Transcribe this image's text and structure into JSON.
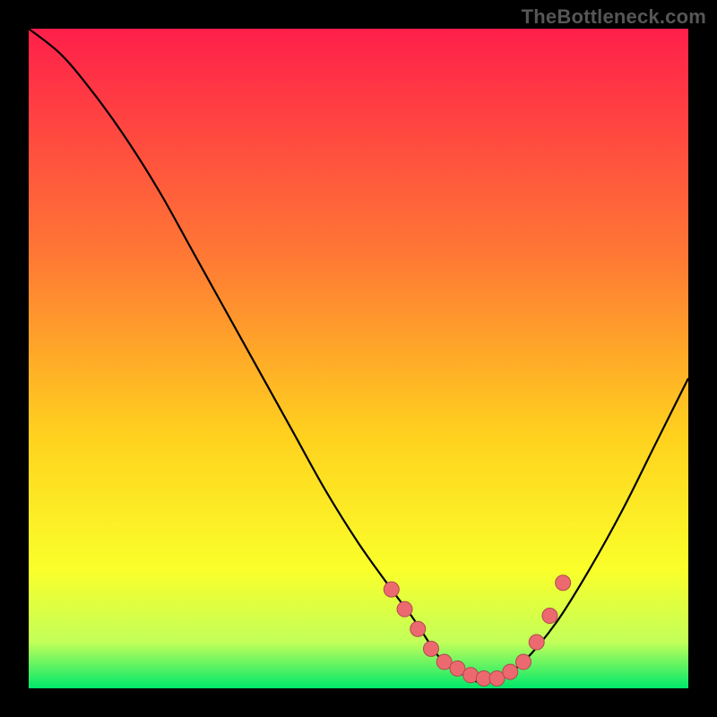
{
  "watermark": "TheBottleneck.com",
  "colors": {
    "top": "#ff1f4a",
    "mid1": "#ff7a34",
    "mid2": "#ffd21e",
    "mid3": "#faff2a",
    "mid4": "#c2ff59",
    "bottom": "#00e86b",
    "curve": "#000000",
    "marker_fill": "#ec6a6f",
    "marker_stroke": "#b04a4f"
  },
  "chart_data": {
    "type": "line",
    "title": "",
    "xlabel": "",
    "ylabel": "",
    "xlim": [
      0,
      100
    ],
    "ylim": [
      0,
      100
    ],
    "x": [
      0,
      5,
      10,
      15,
      20,
      25,
      30,
      35,
      40,
      45,
      50,
      55,
      58,
      60,
      62,
      64,
      66,
      68,
      70,
      72,
      75,
      80,
      85,
      90,
      95,
      100
    ],
    "y": [
      100,
      96,
      90,
      83,
      75,
      66,
      57,
      48,
      39,
      30,
      22,
      15,
      11,
      8,
      5,
      3,
      2,
      1,
      1,
      2,
      4,
      10,
      18,
      27,
      37,
      47
    ],
    "markers_x": [
      55,
      57,
      59,
      61,
      63,
      65,
      67,
      69,
      71,
      73,
      75,
      77,
      79,
      81
    ],
    "markers_y": [
      15,
      12,
      9,
      6,
      4,
      3,
      2,
      1.5,
      1.5,
      2.5,
      4,
      7,
      11,
      16
    ]
  }
}
